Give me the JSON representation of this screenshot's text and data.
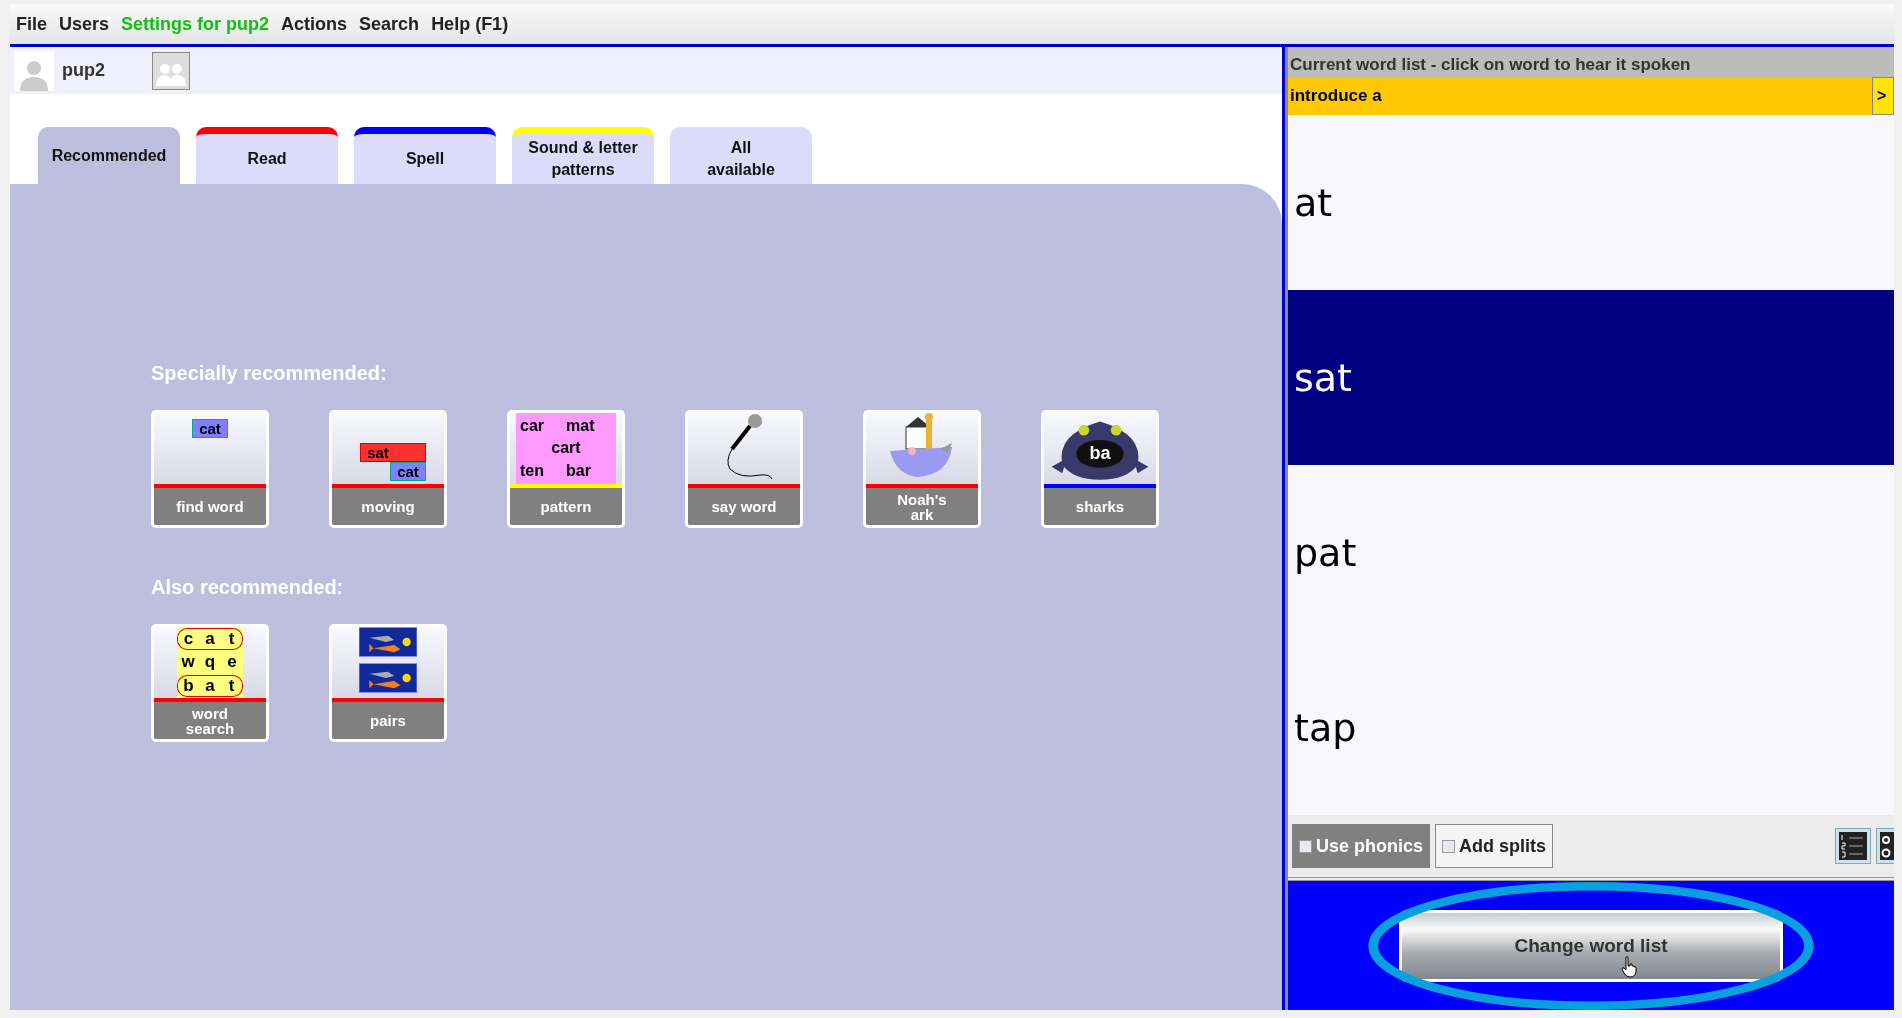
{
  "menu": [
    {
      "label": "File",
      "selected": false
    },
    {
      "label": "Users",
      "selected": false
    },
    {
      "label": "Settings for pup2",
      "selected": true
    },
    {
      "label": "Actions",
      "selected": false
    },
    {
      "label": "Search",
      "selected": false
    },
    {
      "label": "Help (F1)",
      "selected": false
    }
  ],
  "user": {
    "name": "pup2"
  },
  "tabs": [
    {
      "label": "Recommended",
      "selected": true
    },
    {
      "label": "Read",
      "selected": false,
      "color": "#ff0000"
    },
    {
      "label": "Spell",
      "selected": false,
      "color": "#0000ff"
    },
    {
      "label": "Sound & letter\npatterns",
      "selected": false,
      "color": "#ffff00"
    },
    {
      "label": "All\navailable",
      "selected": false
    }
  ],
  "sections": [
    {
      "heading": "Specially recommended:",
      "tiles": [
        {
          "label": "find word",
          "kind": "find",
          "color": "#ff0000",
          "art_words": [
            "cat"
          ]
        },
        {
          "label": "moving",
          "kind": "moving",
          "color": "#ff0000",
          "art_words": [
            "sat",
            "cat"
          ]
        },
        {
          "label": "pattern",
          "kind": "pattern",
          "color": "#ffff00",
          "art_words": [
            "car",
            "mat",
            "cart",
            "ten",
            "bar"
          ]
        },
        {
          "label": "say word",
          "kind": "mic",
          "color": "#ff0000"
        },
        {
          "label": "Noah's\nark",
          "kind": "ark",
          "color": "#ff0000"
        },
        {
          "label": "sharks",
          "kind": "shark",
          "color": "#0000ff",
          "art_words": [
            "ba"
          ]
        }
      ]
    },
    {
      "heading": "Also recommended:",
      "tiles": [
        {
          "label": "word\nsearch",
          "kind": "wordsearch",
          "color": "#ff0000",
          "art_words": [
            "c",
            "a",
            "t",
            "w",
            "q",
            "e",
            "b",
            "a",
            "t"
          ]
        },
        {
          "label": "pairs",
          "kind": "pairs",
          "color": "#ff0000"
        }
      ]
    }
  ],
  "word_list": {
    "header": "Current word list - click on word to hear it spoken",
    "title": "introduce a",
    "next": ">",
    "words": [
      {
        "text": "at",
        "selected": false
      },
      {
        "text": "sat",
        "selected": true
      },
      {
        "text": "pat",
        "selected": false
      },
      {
        "text": "tap",
        "selected": false
      }
    ],
    "toggles": [
      {
        "label": "Use phonics",
        "on": true
      },
      {
        "label": "Add splits",
        "on": false
      }
    ],
    "change_button": "Change word list"
  }
}
